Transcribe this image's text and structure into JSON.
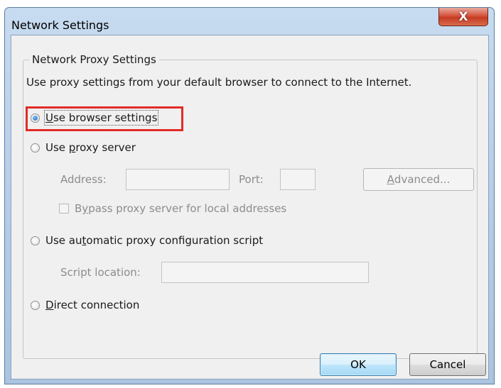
{
  "window": {
    "title": "Network Settings",
    "close_glyph": "X"
  },
  "group": {
    "legend": "Network Proxy Settings",
    "description": "Use proxy settings from your default browser to connect to the Internet."
  },
  "options": {
    "browser": {
      "pre": "",
      "ul": "U",
      "post": "se browser settings",
      "selected": true
    },
    "proxy": {
      "pre": "Use ",
      "ul": "p",
      "post": "roxy server",
      "selected": false
    },
    "auto": {
      "pre": "Use au",
      "ul": "t",
      "post": "omatic proxy configuration script",
      "selected": false
    },
    "direct": {
      "pre": "",
      "ul": "D",
      "post": "irect connection",
      "selected": false
    }
  },
  "proxy_fields": {
    "address_label": "Address:",
    "address_value": "",
    "port_label": "Port:",
    "port_value": "",
    "advanced_pre": "",
    "advanced_ul": "A",
    "advanced_post": "dvanced...",
    "bypass_pre": "B",
    "bypass_ul": "y",
    "bypass_post": "pass proxy server for local addresses",
    "bypass_checked": false
  },
  "script_fields": {
    "location_label": "Script location:",
    "location_value": ""
  },
  "footer": {
    "ok_label": "OK",
    "cancel_label": "Cancel"
  },
  "colors": {
    "highlight_box": "#e12b27",
    "disabled_text": "#8c8c8c"
  }
}
